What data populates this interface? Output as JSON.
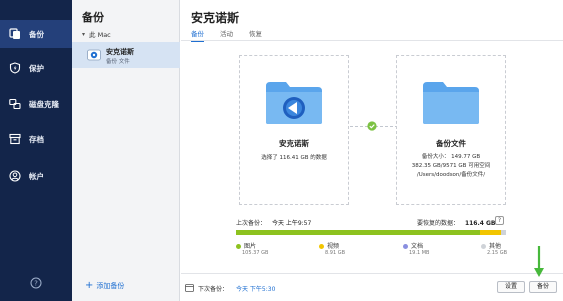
{
  "nav": {
    "items": [
      {
        "label": "备份",
        "icon": "copy-icon",
        "active": true
      },
      {
        "label": "保护",
        "icon": "shield-icon",
        "active": false
      },
      {
        "label": "磁盘克隆",
        "icon": "disk-clone-icon",
        "active": false
      },
      {
        "label": "存档",
        "icon": "archive-icon",
        "active": false
      },
      {
        "label": "帐户",
        "icon": "account-icon",
        "active": false
      }
    ],
    "help_icon": "help-icon"
  },
  "sidebar": {
    "title": "备份",
    "source": "此 Mac",
    "backup_item": {
      "name": "安克诺斯",
      "subtitle": "备份 文件"
    },
    "add_backup": "添加备份"
  },
  "main": {
    "title": "安克诺斯",
    "tabs": [
      {
        "label": "备份",
        "active": true
      },
      {
        "label": "活动",
        "active": false
      },
      {
        "label": "恢复",
        "active": false
      }
    ],
    "source_card": {
      "title": "安克诺斯",
      "line1": "选择了 116.41 GB 的数据"
    },
    "dest_card": {
      "title": "备份文件",
      "line1": "备份大小： 149.77 GB",
      "line2": "382.35 GB/9571 GB 可用空间",
      "line3": "/Users/doodson/备份文件/"
    },
    "last_backup_label": "上次备份：",
    "last_backup_value": "今天 上午9:57",
    "restore_label": "要恢复的数据：",
    "restore_value": "116.4 GB",
    "help": "?",
    "legend": [
      {
        "label": "图片",
        "size": "105.37 GB",
        "color": "#8dc21f"
      },
      {
        "label": "视频",
        "size": "8.91 GB",
        "color": "#f2c500"
      },
      {
        "label": "文档",
        "size": "19.1 MB",
        "color": "#8a8fe0"
      },
      {
        "label": "其他",
        "size": "2.15 GB",
        "color": "#cfd3d8"
      }
    ],
    "usage_fractions": [
      0.905,
      0.077,
      0.001,
      0.017
    ],
    "next_backup_label": "下次备份：",
    "next_backup_value": "今天 下午5:30",
    "settings_button": "设置",
    "backup_button": "备份"
  },
  "colors": {
    "nav_bg": "#13254a",
    "nav_active": "#24407a",
    "accent": "#1f6fd1",
    "check_green": "#7cc243",
    "arrow_green": "#47b83b"
  }
}
